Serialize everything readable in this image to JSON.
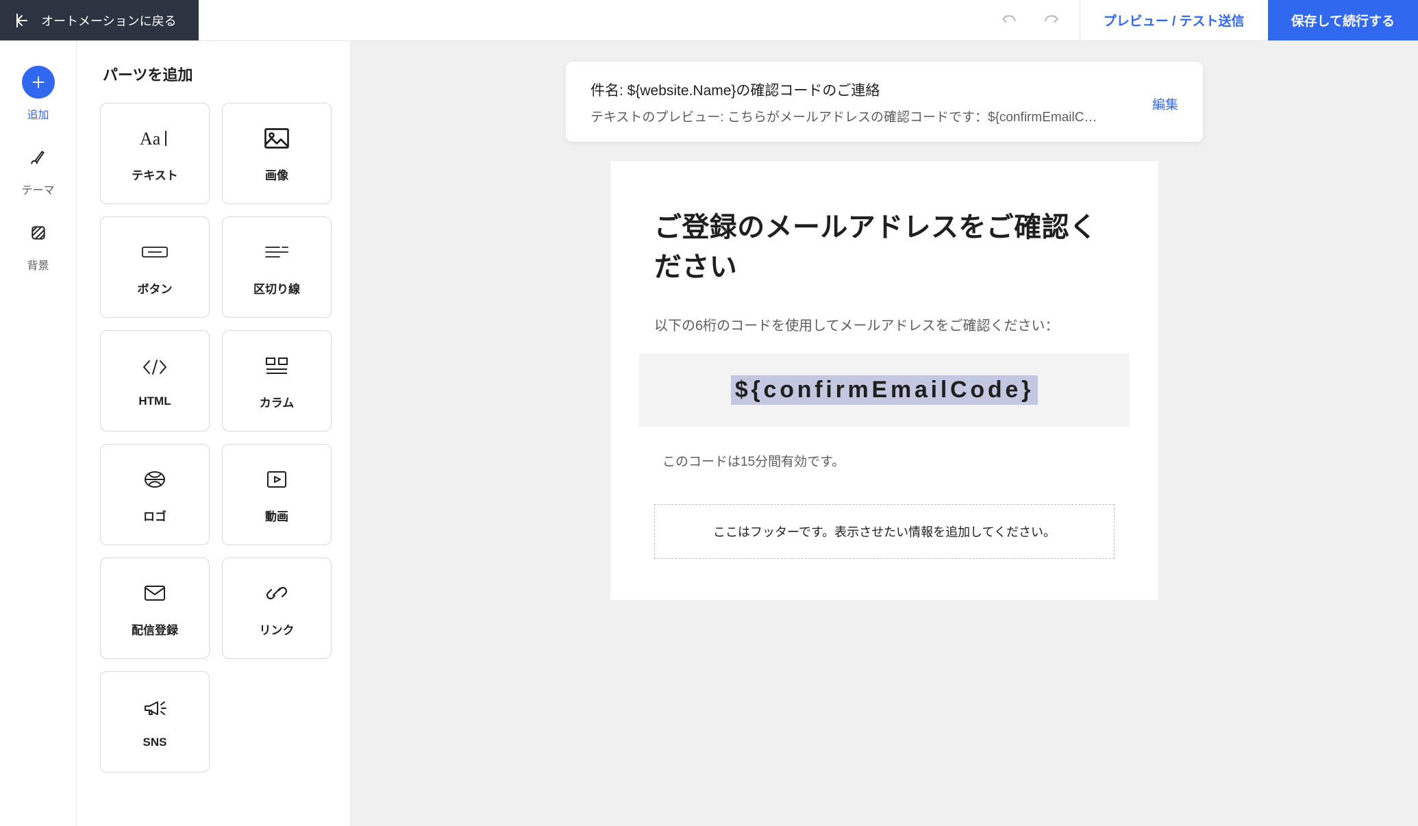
{
  "header": {
    "back_label": "オートメーションに戻る",
    "preview_label": "プレビュー / テスト送信",
    "save_label": "保存して続行する"
  },
  "rail": {
    "items": [
      {
        "id": "add",
        "label": "追加"
      },
      {
        "id": "theme",
        "label": "テーマ"
      },
      {
        "id": "background",
        "label": "背景"
      }
    ]
  },
  "parts": {
    "title": "パーツを追加",
    "items": [
      {
        "id": "text",
        "label": "テキスト"
      },
      {
        "id": "image",
        "label": "画像"
      },
      {
        "id": "button",
        "label": "ボタン"
      },
      {
        "id": "divider",
        "label": "区切り線"
      },
      {
        "id": "html",
        "label": "HTML"
      },
      {
        "id": "column",
        "label": "カラム"
      },
      {
        "id": "logo",
        "label": "ロゴ"
      },
      {
        "id": "video",
        "label": "動画"
      },
      {
        "id": "subscribe",
        "label": "配信登録"
      },
      {
        "id": "link",
        "label": "リンク"
      },
      {
        "id": "sns",
        "label": "SNS"
      }
    ]
  },
  "subject_card": {
    "subject_prefix": "件名: ",
    "subject_value": "${website.Name}の確認コードのご連絡",
    "preview_prefix": "テキストのプレビュー: ",
    "preview_value": "こちらがメールアドレスの確認コードです：${confirmEmailC…",
    "edit_label": "編集"
  },
  "email": {
    "heading": "ご登録のメールアドレスをご確認ください",
    "instruction": "以下の6桁のコードを使用してメールアドレスをご確認ください：",
    "code_token": "${confirmEmailCode}",
    "validity": "このコードは15分間有効です。",
    "footer_placeholder": "ここはフッターです。表示させたい情報を追加してください。"
  }
}
